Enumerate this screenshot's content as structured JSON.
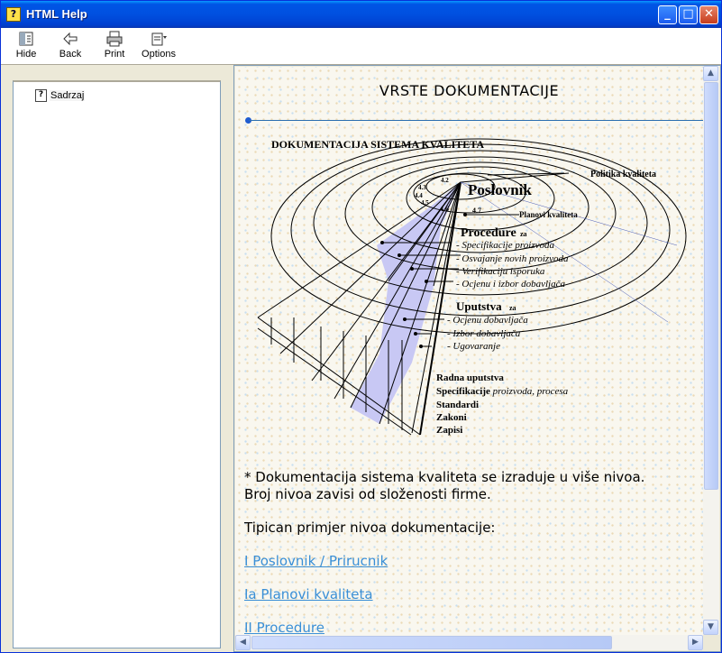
{
  "window": {
    "title": "HTML Help",
    "buttons": [
      "_",
      "□",
      "✕"
    ]
  },
  "toolbar": {
    "hide_label": "Hide",
    "back_label": "Back",
    "print_label": "Print",
    "options_label": "Options",
    "icons": {
      "hide": "hide-icon",
      "back": "back-arrow-icon",
      "print": "printer-icon",
      "options": "options-icon"
    }
  },
  "toc": {
    "items": [
      {
        "label": "Sadrzaj",
        "icon": "help-page-icon"
      }
    ]
  },
  "page": {
    "heading": "VRSTE DOKUMENTACIJE",
    "figure": {
      "title": "DOKUMENTACIJA  SISTEMA KVALITETA",
      "labels": {
        "politika": "Politika kvaliteta",
        "poslovnik": "Poslovnik",
        "planovi": "Planovi kvaliteta",
        "procedure": "Procedure",
        "za": "za",
        "n42": "4.2",
        "n43": "4.3",
        "n44": "4.4",
        "n45": "4.5",
        "n46": "4.6",
        "n47": "4.7",
        "proc_items": [
          "- Specifikacije proizvoda",
          "- Osvajanje novih proizvoda",
          "- Verifikaciju isporuka",
          "- Ocjenu i izbor dobavljača"
        ],
        "uputstva": "Uputstva",
        "up_items": [
          "- Ocjenu dobavljača",
          "- Izbor dobavljača",
          "- Ugovaranje"
        ],
        "radna": "Radna uputstva",
        "spec_bold": "Specifikacije",
        "spec_ital": " proizvoda, procesa",
        "standardi": "Standardi",
        "zakoni": "Zakoni",
        "zapisi": "Zapisi"
      }
    },
    "para1_line1": "* Dokumentacija sistema kvaliteta se izraduje u više nivoa.",
    "para1_line2": "Broj nivoa zavisi od složenosti firme.",
    "para2": "Tipican primjer nivoa dokumentacije:",
    "links": [
      "I Poslovnik / Prirucnik",
      "Ia Planovi kvaliteta",
      "II Procedure"
    ]
  },
  "colors": {
    "accent_line": "#2a6fb0",
    "link": "#3a8fd6",
    "wedge_fill": "#c8c8f4"
  }
}
